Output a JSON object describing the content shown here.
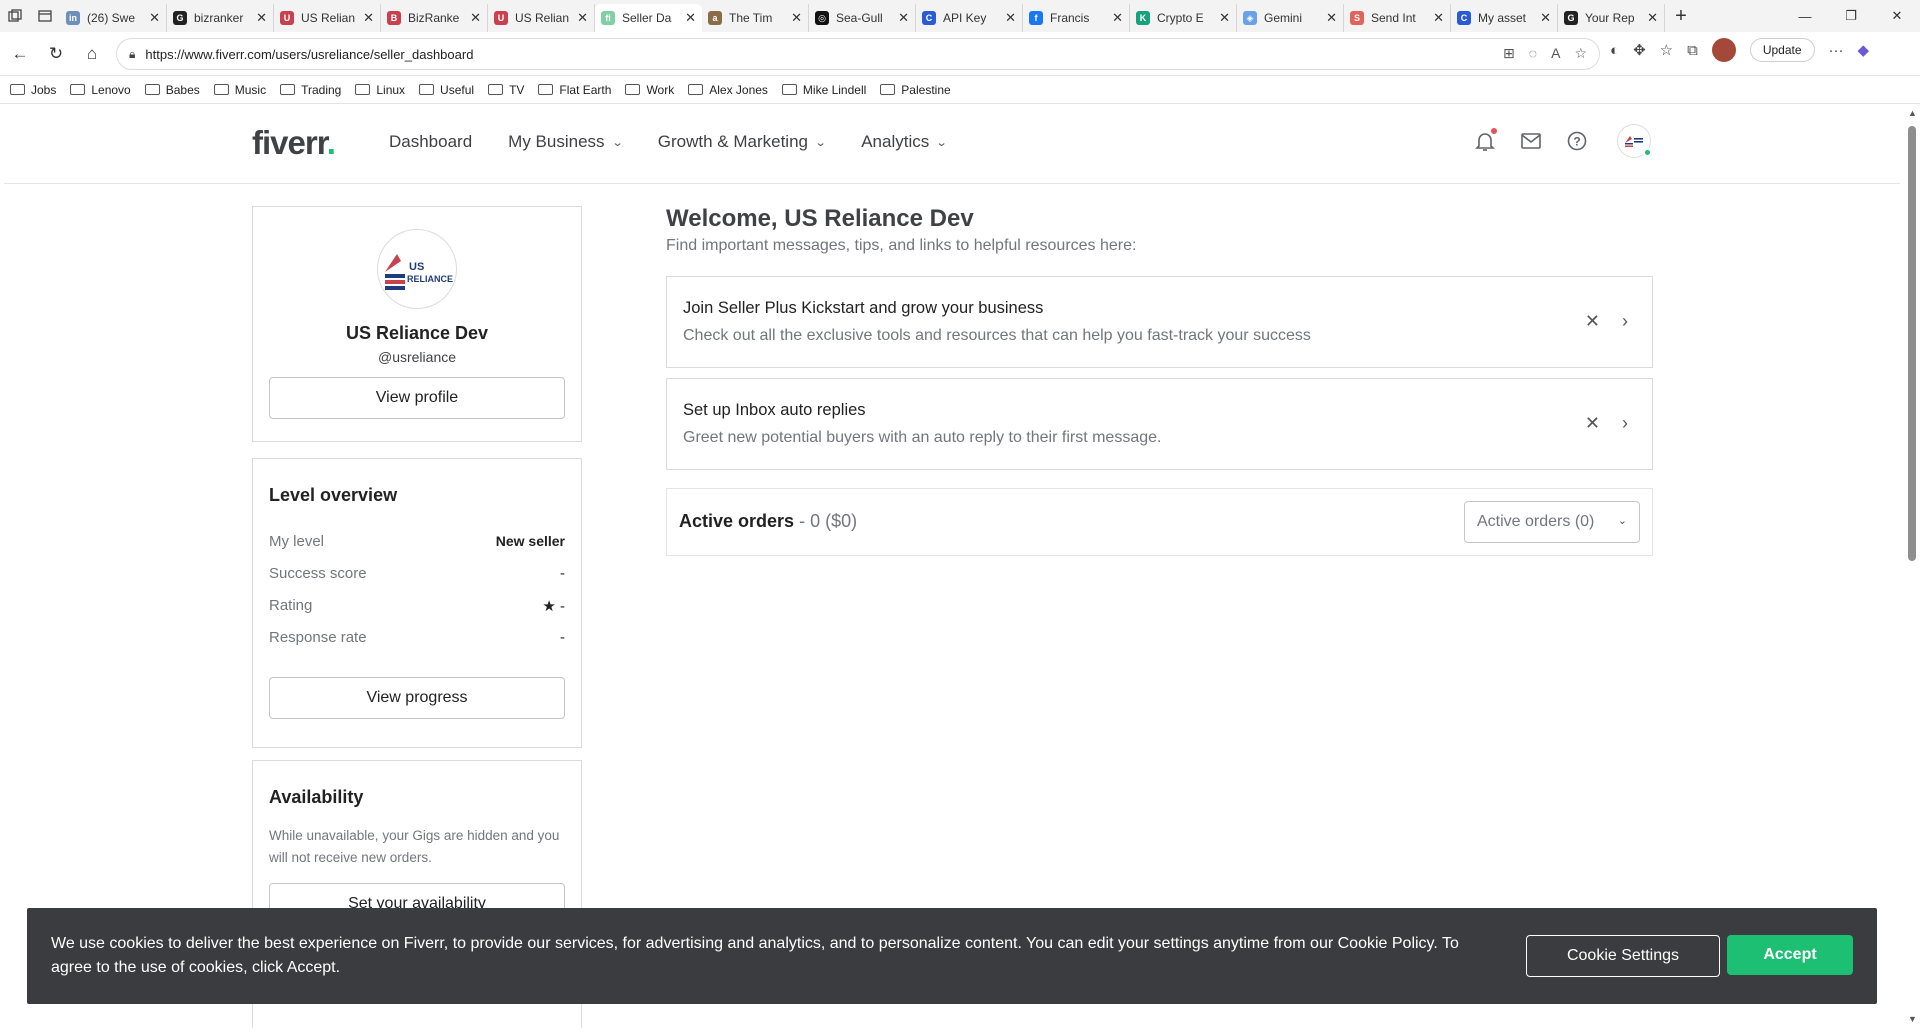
{
  "browser": {
    "tabs": [
      {
        "title": "(26) Swe",
        "color": "#6d8fb8",
        "glyph": "in"
      },
      {
        "title": "bizranker",
        "color": "#222222",
        "glyph": "G"
      },
      {
        "title": "US Relian",
        "color": "#c8414f",
        "glyph": "U"
      },
      {
        "title": "BizRanke",
        "color": "#c8414f",
        "glyph": "B"
      },
      {
        "title": "US Relian",
        "color": "#c8414f",
        "glyph": "U"
      },
      {
        "title": "Seller Da",
        "color": "#7fd1a4",
        "glyph": "fi"
      },
      {
        "title": "The Tim",
        "color": "#8a6d46",
        "glyph": "a"
      },
      {
        "title": "Sea-Gull",
        "color": "#111111",
        "glyph": "◎"
      },
      {
        "title": "API Key",
        "color": "#2a5bd7",
        "glyph": "C"
      },
      {
        "title": "Francis",
        "color": "#1877f2",
        "glyph": "f"
      },
      {
        "title": "Crypto E",
        "color": "#16a37c",
        "glyph": "K"
      },
      {
        "title": "Gemini",
        "color": "#6aa1e6",
        "glyph": "◈"
      },
      {
        "title": "Send Int",
        "color": "#e0645a",
        "glyph": "S"
      },
      {
        "title": "My asset",
        "color": "#2a5bd7",
        "glyph": "C"
      },
      {
        "title": "Your Rep",
        "color": "#222222",
        "glyph": "G"
      }
    ],
    "active_tab_index": 5,
    "url": "https://www.fiverr.com/users/usreliance/seller_dashboard",
    "update_label": "Update",
    "bookmarks": [
      "Jobs",
      "Lenovo",
      "Babes",
      "Music",
      "Trading",
      "Linux",
      "Useful",
      "TV",
      "Flat Earth",
      "Work",
      "Alex Jones",
      "Mike Lindell",
      "Palestine"
    ]
  },
  "header": {
    "logo": "fiverr",
    "logo_dot": ".",
    "nav": [
      "Dashboard",
      "My Business",
      "Growth & Marketing",
      "Analytics"
    ],
    "brand_color": "#1dbf73"
  },
  "profile": {
    "avatar_text_1": "US",
    "avatar_text_2": "RELIANCE",
    "name": "US Reliance Dev",
    "handle": "@usreliance",
    "view_profile": "View profile"
  },
  "level": {
    "title": "Level overview",
    "rows": [
      {
        "label": "My level",
        "value": "New seller"
      },
      {
        "label": "Success score",
        "value": "-"
      },
      {
        "label": "Rating",
        "value": "★ -"
      },
      {
        "label": "Response rate",
        "value": "-"
      }
    ],
    "button": "View progress"
  },
  "availability": {
    "title": "Availability",
    "description": "While unavailable, your Gigs are hidden and you will not receive new orders.",
    "button": "Set your availability"
  },
  "main": {
    "welcome": "Welcome, US Reliance Dev",
    "subtitle": "Find important messages, tips, and links to helpful resources here:",
    "messages": [
      {
        "title": "Join Seller Plus Kickstart and grow your business",
        "desc": "Check out all the exclusive tools and resources that can help you fast-track your success"
      },
      {
        "title": "Set up Inbox auto replies",
        "desc": "Greet new potential buyers with an auto reply to their first message."
      }
    ],
    "orders": {
      "title": "Active orders",
      "count": "- 0 ($0)",
      "select_value": "Active orders (0)"
    }
  },
  "cookie": {
    "text": "We use cookies to deliver the best experience on Fiverr, to provide our services, for advertising and analytics, and to personalize content. You can edit your settings anytime from our Cookie Policy. To agree to the use of cookies, click Accept.",
    "settings": "Cookie Settings",
    "accept": "Accept"
  }
}
